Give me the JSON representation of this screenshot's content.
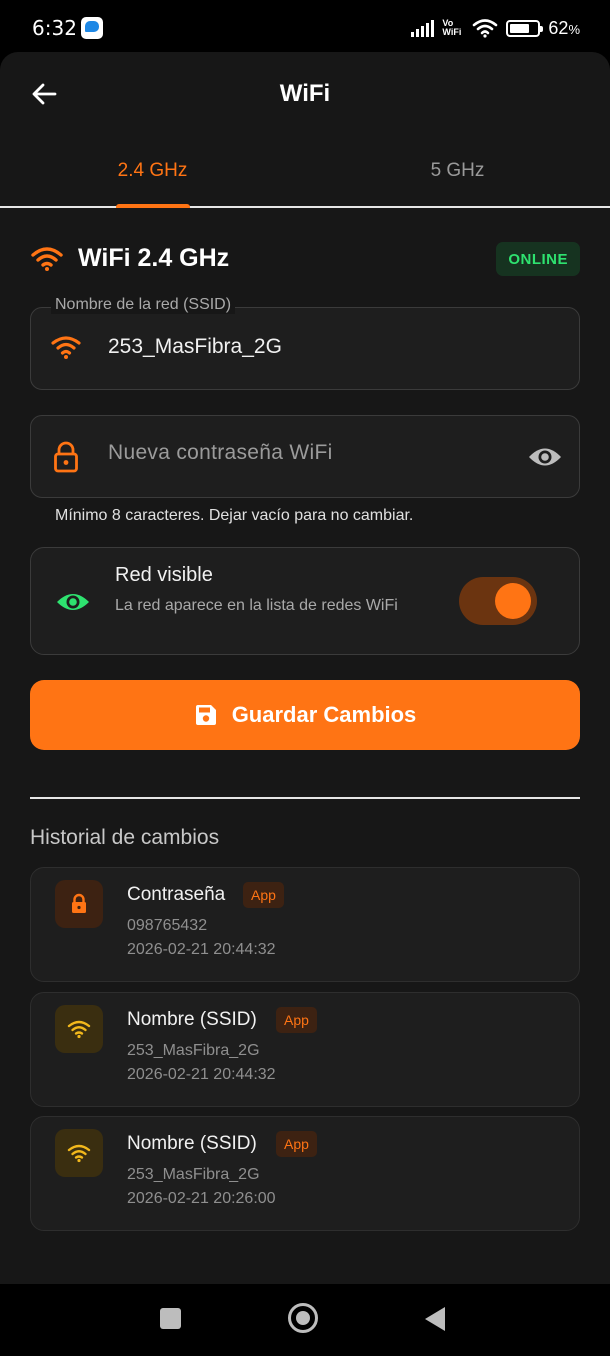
{
  "status_bar": {
    "time": "6:32",
    "network_label_top": "Vo",
    "network_label_bottom": "WiFi",
    "battery_percent": "62",
    "battery_suffix": "%"
  },
  "header": {
    "title": "WiFi",
    "back_icon": "arrow-left-icon"
  },
  "tabs": [
    {
      "label": "2.4 GHz",
      "active": true
    },
    {
      "label": "5 GHz",
      "active": false
    }
  ],
  "network": {
    "title": "WiFi 2.4 GHz",
    "status": "ONLINE",
    "ssid_label": "Nombre de la red (SSID)",
    "ssid_value": "253_MasFibra_2G",
    "password_placeholder": "Nueva contraseña WiFi",
    "password_value": "",
    "password_helper": "Mínimo 8 caracteres. Dejar vacío para no cambiar.",
    "visible_title": "Red visible",
    "visible_description": "La red aparece en la lista de redes WiFi",
    "visible_enabled": true,
    "save_label": "Guardar Cambios"
  },
  "history": {
    "title": "Historial de cambios",
    "items": [
      {
        "title": "Contraseña",
        "badge": "App",
        "detail": "098765432",
        "date": "2026-02-21 20:44:32",
        "icon": "lock-icon"
      },
      {
        "title": "Nombre (SSID)",
        "badge": "App",
        "detail": "253_MasFibra_2G",
        "date": "2026-02-21 20:44:32",
        "icon": "wifi-icon"
      },
      {
        "title": "Nombre (SSID)",
        "badge": "App",
        "detail": "253_MasFibra_2G",
        "date": "2026-02-21 20:26:00",
        "icon": "wifi-icon"
      }
    ]
  },
  "colors": {
    "accent": "#ff7414",
    "online": "#2ee26f",
    "visible_icon": "#2ee26f",
    "wifi_history": "#f2b81c",
    "background": "#171717",
    "card": "#1e1e1e"
  }
}
